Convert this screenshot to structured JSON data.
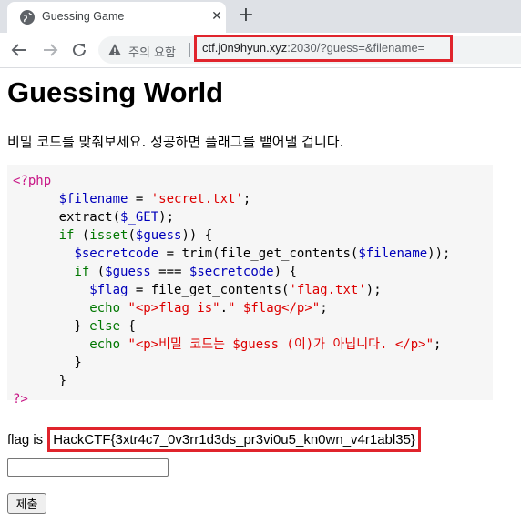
{
  "browser": {
    "tab_title": "Guessing Game",
    "tab_close": "✕",
    "new_tab": "+",
    "security_label": "주의 요함",
    "url_host": "ctf.j0n9hyun.xyz",
    "url_rest": ":2030/?guess=&filename="
  },
  "page": {
    "title": "Guessing World",
    "intro": "비밀 코드를 맞춰보세요. 성공하면 플래그를 뱉어낼 겁니다.",
    "code_lines": [
      [
        {
          "c": "tk-php",
          "t": "<?php"
        }
      ],
      [
        {
          "c": "tk-def",
          "t": "      "
        },
        {
          "c": "tk-var",
          "t": "$filename"
        },
        {
          "c": "tk-def",
          "t": " = "
        },
        {
          "c": "tk-str",
          "t": "'secret.txt'"
        },
        {
          "c": "tk-def",
          "t": ";"
        }
      ],
      [
        {
          "c": "tk-def",
          "t": "      extract("
        },
        {
          "c": "tk-var",
          "t": "$_GET"
        },
        {
          "c": "tk-def",
          "t": ");"
        }
      ],
      [
        {
          "c": "tk-def",
          "t": "      "
        },
        {
          "c": "tk-kw",
          "t": "if"
        },
        {
          "c": "tk-def",
          "t": " ("
        },
        {
          "c": "tk-kw",
          "t": "isset"
        },
        {
          "c": "tk-def",
          "t": "("
        },
        {
          "c": "tk-var",
          "t": "$guess"
        },
        {
          "c": "tk-def",
          "t": ")) {"
        }
      ],
      [
        {
          "c": "tk-def",
          "t": "        "
        },
        {
          "c": "tk-var",
          "t": "$secretcode"
        },
        {
          "c": "tk-def",
          "t": " = trim(file_get_contents("
        },
        {
          "c": "tk-var",
          "t": "$filename"
        },
        {
          "c": "tk-def",
          "t": "));"
        }
      ],
      [
        {
          "c": "tk-def",
          "t": "        "
        },
        {
          "c": "tk-kw",
          "t": "if"
        },
        {
          "c": "tk-def",
          "t": " ("
        },
        {
          "c": "tk-var",
          "t": "$guess"
        },
        {
          "c": "tk-def",
          "t": " === "
        },
        {
          "c": "tk-var",
          "t": "$secretcode"
        },
        {
          "c": "tk-def",
          "t": ") {"
        }
      ],
      [
        {
          "c": "tk-def",
          "t": "          "
        },
        {
          "c": "tk-var",
          "t": "$flag"
        },
        {
          "c": "tk-def",
          "t": " = file_get_contents("
        },
        {
          "c": "tk-str",
          "t": "'flag.txt'"
        },
        {
          "c": "tk-def",
          "t": ");"
        }
      ],
      [
        {
          "c": "tk-def",
          "t": "          "
        },
        {
          "c": "tk-echo",
          "t": "echo"
        },
        {
          "c": "tk-def",
          "t": " "
        },
        {
          "c": "tk-str",
          "t": "\"<p>flag is\""
        },
        {
          "c": "tk-def",
          "t": "."
        },
        {
          "c": "tk-str",
          "t": "\" $flag</p>\""
        },
        {
          "c": "tk-def",
          "t": ";"
        }
      ],
      [
        {
          "c": "tk-def",
          "t": "        } "
        },
        {
          "c": "tk-kw",
          "t": "else"
        },
        {
          "c": "tk-def",
          "t": " {"
        }
      ],
      [
        {
          "c": "tk-def",
          "t": "          "
        },
        {
          "c": "tk-echo",
          "t": "echo"
        },
        {
          "c": "tk-def",
          "t": " "
        },
        {
          "c": "tk-str",
          "t": "\"<p>비밀 코드는 $guess (이)가 아닙니다. </p>\""
        },
        {
          "c": "tk-def",
          "t": ";"
        }
      ],
      [
        {
          "c": "tk-def",
          "t": "        }"
        }
      ],
      [
        {
          "c": "tk-def",
          "t": "      }"
        }
      ],
      [
        {
          "c": "tk-php",
          "t": "?>"
        }
      ]
    ],
    "flag_label": "flag is",
    "flag_value": "HackCTF{3xtr4c7_0v3rr1d3ds_pr3vi0u5_kn0wn_v4r1abl35}",
    "guess_input": {
      "value": "",
      "placeholder": ""
    },
    "submit_label": "제출"
  },
  "colors": {
    "highlight_box": "#e0242c",
    "php_tag": "#c71585",
    "variable": "#0000bb",
    "string": "#dd0000",
    "keyword": "#007700"
  },
  "icons": [
    "globe-icon",
    "close-icon",
    "plus-icon",
    "back-arrow-icon",
    "forward-arrow-icon",
    "reload-icon",
    "warning-icon"
  ]
}
